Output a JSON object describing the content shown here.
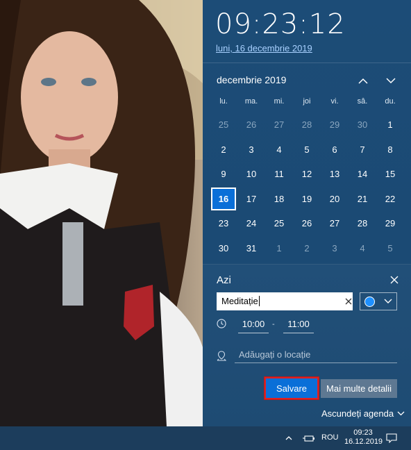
{
  "clock": {
    "time": "09:23:12",
    "date_long": "luni, 16 decembrie 2019"
  },
  "calendar": {
    "month_label": "decembrie 2019",
    "nav_up_icon": "chevron-up-icon",
    "nav_down_icon": "chevron-down-icon",
    "weekdays": [
      "lu.",
      "ma.",
      "mi.",
      "joi",
      "vi.",
      "sâ.",
      "du."
    ],
    "days": [
      {
        "label": "25",
        "muted": true
      },
      {
        "label": "26",
        "muted": true
      },
      {
        "label": "27",
        "muted": true
      },
      {
        "label": "28",
        "muted": true
      },
      {
        "label": "29",
        "muted": true
      },
      {
        "label": "30",
        "muted": true
      },
      {
        "label": "1",
        "muted": false
      },
      {
        "label": "2",
        "muted": false
      },
      {
        "label": "3",
        "muted": false
      },
      {
        "label": "4",
        "muted": false
      },
      {
        "label": "5",
        "muted": false
      },
      {
        "label": "6",
        "muted": false
      },
      {
        "label": "7",
        "muted": false
      },
      {
        "label": "8",
        "muted": false
      },
      {
        "label": "9",
        "muted": false
      },
      {
        "label": "10",
        "muted": false
      },
      {
        "label": "11",
        "muted": false
      },
      {
        "label": "12",
        "muted": false
      },
      {
        "label": "13",
        "muted": false
      },
      {
        "label": "14",
        "muted": false
      },
      {
        "label": "15",
        "muted": false
      },
      {
        "label": "16",
        "muted": false,
        "today": true
      },
      {
        "label": "17",
        "muted": false
      },
      {
        "label": "18",
        "muted": false
      },
      {
        "label": "19",
        "muted": false
      },
      {
        "label": "20",
        "muted": false
      },
      {
        "label": "21",
        "muted": false
      },
      {
        "label": "22",
        "muted": false
      },
      {
        "label": "23",
        "muted": false
      },
      {
        "label": "24",
        "muted": false
      },
      {
        "label": "25",
        "muted": false
      },
      {
        "label": "26",
        "muted": false
      },
      {
        "label": "27",
        "muted": false
      },
      {
        "label": "28",
        "muted": false
      },
      {
        "label": "29",
        "muted": false
      },
      {
        "label": "30",
        "muted": false
      },
      {
        "label": "31",
        "muted": false
      },
      {
        "label": "1",
        "muted": true
      },
      {
        "label": "2",
        "muted": true
      },
      {
        "label": "3",
        "muted": true
      },
      {
        "label": "4",
        "muted": true
      },
      {
        "label": "5",
        "muted": true
      }
    ]
  },
  "agenda": {
    "title": "Azi",
    "event_name": "Meditație",
    "color_dot": "#1e90ff",
    "start_time": "10:00",
    "end_time": "11:00",
    "time_separator": "-",
    "location_placeholder": "Adăugați o locație",
    "save_label": "Salvare",
    "more_details_label": "Mai multe detalii",
    "hide_agenda_label": "Ascundeți agenda"
  },
  "taskbar": {
    "language": "ROU",
    "time": "09:23",
    "date": "16.12.2019"
  },
  "colors": {
    "accent": "#0a6fd8",
    "highlight_border": "#e02020"
  }
}
